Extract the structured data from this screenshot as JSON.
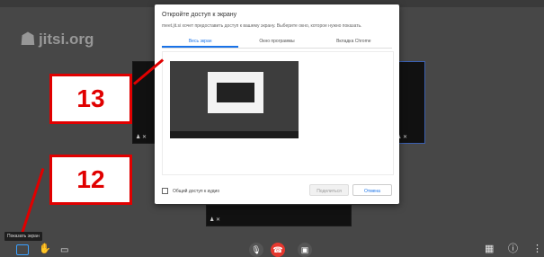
{
  "brand": {
    "logo_text": "jitsi.org",
    "logo_icon": "jitsi-person-icon"
  },
  "dialog": {
    "title": "Откройте доступ к экрану",
    "subtitle": "meet.jit.si хочет предоставить доступ к вашему экрану. Выберите окно, которое нужно показать.",
    "tabs": [
      {
        "label": "Весь экран",
        "active": true
      },
      {
        "label": "Окно программы",
        "active": false
      },
      {
        "label": "Вкладка Chrome",
        "active": false
      }
    ],
    "audio_label": "Общий доступ к аудио",
    "share_label": "Поделиться",
    "cancel_label": "Отмена"
  },
  "annotations": {
    "badge_13": "13",
    "badge_12": "12"
  },
  "tooltip": {
    "text": "Показать экран"
  },
  "toolbar": {
    "icons": [
      "screen-share-icon",
      "raise-hand-icon",
      "chat-icon",
      "microphone-muted-icon",
      "hangup-icon",
      "camera-muted-icon",
      "tile-view-icon",
      "info-icon",
      "more-options-icon"
    ]
  },
  "colors": {
    "accent_blue": "#1a73e8",
    "annotation_red": "#e00000",
    "hangup_red": "#e5382f",
    "background": "#474747"
  }
}
